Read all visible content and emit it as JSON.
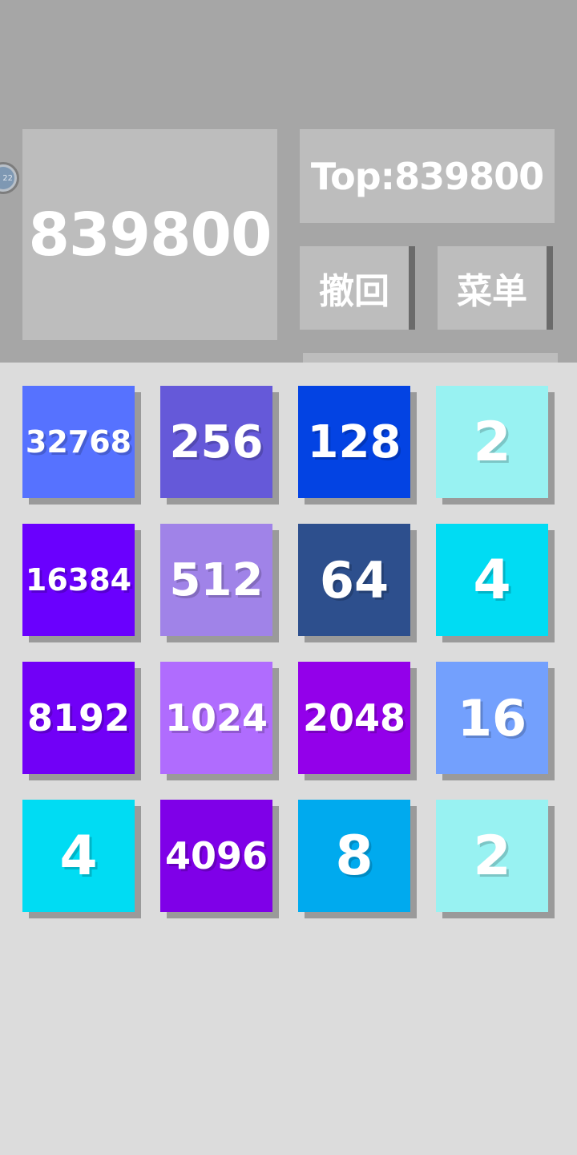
{
  "header": {
    "score": "839800",
    "top_score": "Top:839800",
    "undo_label": "撤回",
    "menu_label": "菜单",
    "badge_text": "22"
  },
  "board": {
    "tiles": [
      {
        "value": "32768",
        "color": "#5672ff"
      },
      {
        "value": "256",
        "color": "#6559d9"
      },
      {
        "value": "128",
        "color": "#0343e3"
      },
      {
        "value": "2",
        "color": "#98f2f2"
      },
      {
        "value": "16384",
        "color": "#6a00fe"
      },
      {
        "value": "512",
        "color": "#a083e8"
      },
      {
        "value": "64",
        "color": "#2d4f8d"
      },
      {
        "value": "4",
        "color": "#00dcf3"
      },
      {
        "value": "8192",
        "color": "#7100f7"
      },
      {
        "value": "1024",
        "color": "#b06cfe"
      },
      {
        "value": "2048",
        "color": "#9300ea"
      },
      {
        "value": "16",
        "color": "#73a0fd"
      },
      {
        "value": "4",
        "color": "#00dcf3"
      },
      {
        "value": "4096",
        "color": "#7f00e8"
      },
      {
        "value": "8",
        "color": "#00aaee"
      },
      {
        "value": "2",
        "color": "#98f2f2"
      }
    ]
  }
}
